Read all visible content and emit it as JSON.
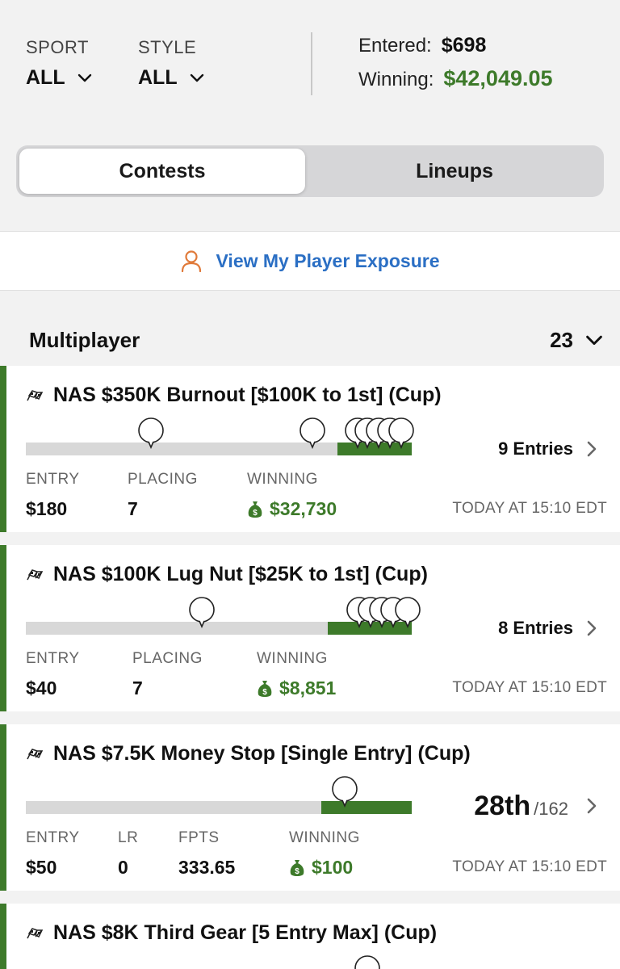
{
  "filters": {
    "sport": {
      "label": "SPORT",
      "value": "ALL"
    },
    "style": {
      "label": "STYLE",
      "value": "ALL"
    }
  },
  "totals": {
    "entered_label": "Entered:",
    "entered_value": "$698",
    "winning_label": "Winning:",
    "winning_value": "$42,049.05"
  },
  "tabs": [
    {
      "label": "Contests",
      "active": true
    },
    {
      "label": "Lineups",
      "active": false
    }
  ],
  "exposure_link": {
    "label": "View My Player Exposure",
    "icon": "person-icon"
  },
  "section": {
    "title": "Multiplayer",
    "count": "23"
  },
  "contests": [
    {
      "name": "NAS $350K Burnout [$100K to 1st] (Cup)",
      "entries": "9 Entries",
      "stats": [
        {
          "label": "ENTRY",
          "value": "$180"
        },
        {
          "label": "PLACING",
          "value": "7"
        },
        {
          "label": "WINNING",
          "value": "$32,730"
        }
      ],
      "time": "TODAY AT 15:10 EDT"
    },
    {
      "name": "NAS $100K Lug Nut [$25K to 1st] (Cup)",
      "entries": "8 Entries",
      "stats": [
        {
          "label": "ENTRY",
          "value": "$40"
        },
        {
          "label": "PLACING",
          "value": "7"
        },
        {
          "label": "WINNING",
          "value": "$8,851"
        }
      ],
      "time": "TODAY AT 15:10 EDT"
    },
    {
      "name": "NAS $7.5K Money Stop [Single Entry] (Cup)",
      "rank": "28th",
      "rank_of": "/162",
      "stats": [
        {
          "label": "ENTRY",
          "value": "$50"
        },
        {
          "label": "LR",
          "value": "0"
        },
        {
          "label": "FPTS",
          "value": "333.65"
        },
        {
          "label": "WINNING",
          "value": "$100"
        }
      ],
      "time": "TODAY AT 15:10 EDT"
    },
    {
      "name": "NAS $8K Third Gear [5 Entry Max] (Cup)"
    }
  ],
  "colors": {
    "accent_green": "#3d7a2a",
    "link_blue": "#2b6fc4",
    "icon_orange": "#e07a3a"
  }
}
